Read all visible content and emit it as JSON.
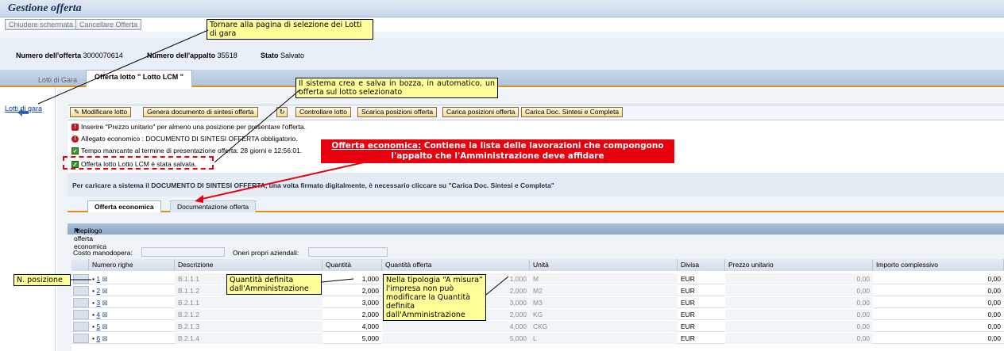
{
  "app_title": "Gestione offerta",
  "top_buttons": {
    "close": "Chiudere schermata",
    "cancel": "Cancellare Offerta"
  },
  "info": {
    "offer_label": "Numero dell'offerta",
    "offer_value": "3000070614",
    "tender_label": "Numero dell'appalto",
    "tender_value": "35518",
    "state_label": "Stato",
    "state_value": "Salvato"
  },
  "outer_tabs": [
    "Lotti di Gara",
    "Offerta lotto \" Lotto LCM \""
  ],
  "back_link": "Lotti di gara",
  "toolbar": {
    "modify": "Modificare lotto",
    "generate": "Genera documento di sintesi offerta",
    "check": "Controllare lotto",
    "download": "Scarica posizioni offerta",
    "upload": "Carica posizioni offerta",
    "upload_doc": "Carica Doc. Sintesi e Completa"
  },
  "messages": [
    {
      "icon": "error-icon",
      "text": "Inserire \"Prezzo unitario\" per almeno una posizione per presentare l'offerta."
    },
    {
      "icon": "warning-icon",
      "text": "Allegato economico : DOCUMENTO DI SINTESI OFFERTA obbligatorio."
    },
    {
      "icon": "success-icon",
      "text": "Tempo mancante al termine di presentazione offerta: 28  giorni e 12:56:01."
    },
    {
      "icon": "success-icon",
      "text": "Offerta lotto Lotto LCM è stata salvata."
    }
  ],
  "info_line": "Per caricare a sistema il DOCUMENTO DI SINTESI OFFERTA, una volta firmato digitalmente, è necessario cliccare su \"Carica Doc. Sintesi e Completa\"",
  "inner_tabs": [
    "Offerta economica",
    "Documentazione offerta"
  ],
  "section_title": "Riepilogo offerta economica",
  "fields": {
    "costo_label": "Costo manodopera:",
    "oneri_label": "Oneri propri aziendali:"
  },
  "table": {
    "headers": [
      "Numero righe",
      "Descrizione",
      "Quantità",
      "Quantità offerta",
      "Unità",
      "Divisa",
      "Prezzo unitario",
      "Importo complessivo"
    ],
    "rows": [
      {
        "num": "1",
        "desc": "B.1.1.1",
        "qty": "1,000",
        "qty_off": "1,000",
        "unit": "M",
        "cur": "EUR",
        "price": "0,00",
        "total": "0,00"
      },
      {
        "num": "2",
        "desc": "B.1.1.2",
        "qty": "2,000",
        "qty_off": "2,000",
        "unit": "M2",
        "cur": "EUR",
        "price": "0,00",
        "total": "0,00"
      },
      {
        "num": "3",
        "desc": "B.2.1.1",
        "qty": "3,000",
        "qty_off": "3,000",
        "unit": "M3",
        "cur": "EUR",
        "price": "0,00",
        "total": "0,00"
      },
      {
        "num": "4",
        "desc": "B.2.1.2",
        "qty": "2,000",
        "qty_off": "2,000",
        "unit": "KG",
        "cur": "EUR",
        "price": "0,00",
        "total": "0,00"
      },
      {
        "num": "5",
        "desc": "B.2.1.3",
        "qty": "4,000",
        "qty_off": "4,000",
        "unit": "CKG",
        "cur": "EUR",
        "price": "0,00",
        "total": "0,00"
      },
      {
        "num": "6",
        "desc": "B.2.1.4",
        "qty": "5,000",
        "qty_off": "5,000",
        "unit": "L",
        "cur": "EUR",
        "price": "0,00",
        "total": "0,00"
      }
    ]
  },
  "annotations": {
    "tornare": "Tornare alla pagina di selezione dei Lotti di gara",
    "sistema": "Il sistema crea e salva in bozza, in automatico, un offerta sul lotto selezionato",
    "offerta_title": "Offerta economica:",
    "offerta_text": " Contiene la lista delle lavorazioni che compongono l'appalto che l'Amministrazione deve affidare",
    "n_posizione": "N. posizione",
    "quantita_definita": "Quantità definita dall'Amministrazione",
    "a_misura": "Nella tipologia “A misura” l'impresa non può modificare la Quantità definita dall'Amministrazione"
  },
  "colors": {
    "accent_orange": "#e58a1c",
    "callout_yellow": "#ffff99",
    "alert_red": "#e8000d"
  }
}
